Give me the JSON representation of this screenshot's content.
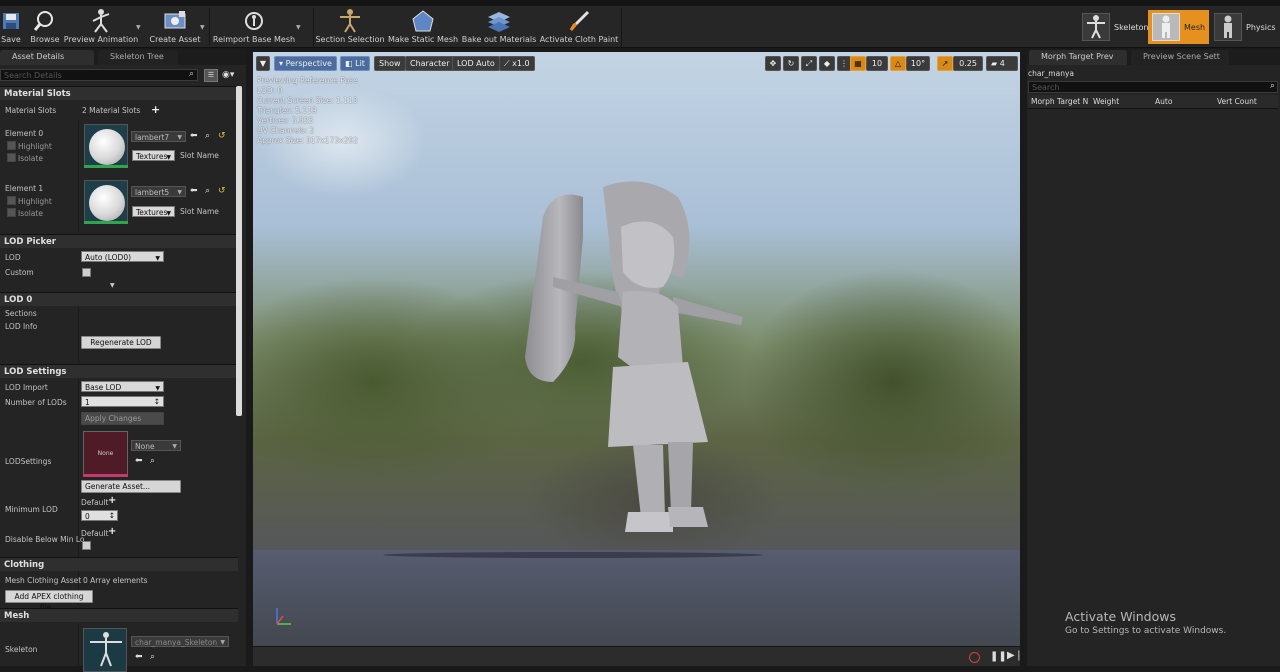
{
  "toolbar": {
    "buttons": [
      {
        "label": "Save",
        "icon": "save-icon"
      },
      {
        "label": "Browse",
        "icon": "browse-icon"
      },
      {
        "label": "Preview Animation",
        "icon": "preview-animation-icon"
      },
      {
        "label": "Create Asset",
        "icon": "create-asset-icon"
      },
      {
        "label": "Reimport Base Mesh",
        "icon": "reimport-icon"
      },
      {
        "label": "Section Selection",
        "icon": "section-selection-icon"
      },
      {
        "label": "Make Static Mesh",
        "icon": "make-static-mesh-icon"
      },
      {
        "label": "Bake out Materials",
        "icon": "bake-materials-icon"
      },
      {
        "label": "Activate Cloth Paint",
        "icon": "cloth-paint-icon"
      }
    ],
    "modes": [
      {
        "label": "Skeleton",
        "icon": "skeleton-mode-icon"
      },
      {
        "label": "Mesh",
        "icon": "mesh-mode-icon"
      },
      {
        "label": "Physics",
        "icon": "physics-mode-icon"
      }
    ],
    "active_mode_color": "#e6911f"
  },
  "left_panel": {
    "tabs": [
      "Asset Details",
      "Skeleton Tree"
    ],
    "search_placeholder": "Search Details",
    "material_slots": {
      "title": "Material Slots",
      "label": "Material Slots",
      "count_text": "2 Material Slots",
      "elements": [
        {
          "label": "Element 0",
          "material": "lambert7",
          "textures": "Textures",
          "slot_name": "Slot Name",
          "highlight": "Highlight",
          "isolate": "Isolate"
        },
        {
          "label": "Element 1",
          "material": "lambert5",
          "textures": "Textures",
          "slot_name": "Slot Name",
          "highlight": "Highlight",
          "isolate": "Isolate"
        }
      ]
    },
    "lod_picker": {
      "title": "LOD Picker",
      "lod_label": "LOD",
      "lod_value": "Auto (LOD0)",
      "custom_label": "Custom"
    },
    "lod0": {
      "title": "LOD 0",
      "sections_label": "Sections",
      "lod_info_label": "LOD Info",
      "regenerate_button": "Regenerate LOD"
    },
    "lod_settings": {
      "title": "LOD Settings",
      "lod_import_label": "LOD Import",
      "lod_import_value": "Base LOD",
      "num_lods_label": "Number of LODs",
      "num_lods_value": "1",
      "apply_button": "Apply Changes",
      "lodsettings_label": "LODSettings",
      "lodsettings_thumb": "None",
      "lodsettings_value": "None",
      "generate_button": "Generate Asset...",
      "min_lod_label": "Minimum LOD",
      "min_lod_default": "Default",
      "min_lod_value": "0",
      "disable_label": "Disable Below Min Lo",
      "disable_default": "Default"
    },
    "clothing": {
      "title": "Clothing",
      "mesh_clothing_label": "Mesh Clothing Asset",
      "mesh_clothing_value": "0 Array elements",
      "add_button": "Add APEX clothing file..."
    },
    "mesh": {
      "title": "Mesh",
      "skeleton_label": "Skeleton",
      "skeleton_value": "char_manya_Skeleton"
    }
  },
  "viewport": {
    "toolbar": {
      "perspective": "Perspective",
      "lit": "Lit",
      "show": "Show",
      "character": "Character",
      "lod": "LOD Auto",
      "speed": "x1.0",
      "grid_snap": "10",
      "rot_snap": "10°",
      "scale_snap": "0.25",
      "camera_speed": "4"
    },
    "info_lines": [
      "Previewing Reference Pose",
      "LOD: 0",
      "Current Screen Size: 1.113",
      "Triangles: 5,119",
      "Vertices: 3,825",
      "UV Channels: 2",
      "Approx Size: 317x173x292"
    ]
  },
  "right_panel": {
    "tabs": [
      "Morph Target Prev",
      "Preview Scene Sett"
    ],
    "mesh_name": "char_manya",
    "search_placeholder": "Search",
    "columns": [
      "Morph Target N",
      "Weight",
      "Auto",
      "Vert Count"
    ]
  },
  "watermark": {
    "title": "Activate Windows",
    "subtitle": "Go to Settings to activate Windows."
  }
}
